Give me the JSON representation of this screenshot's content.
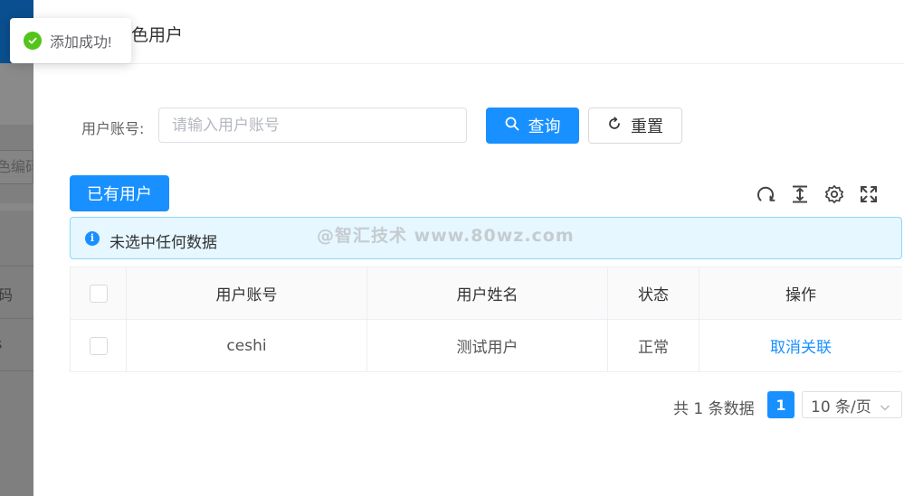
{
  "background_page": {
    "field_text": "色编码",
    "row1_text": "码",
    "row2_text": "s"
  },
  "drawer": {
    "title": "色用户",
    "search": {
      "label": "用户账号:",
      "placeholder": "请输入用户账号",
      "value": "",
      "query_label": "查询",
      "reset_label": "重置"
    },
    "existing_users_label": "已有用户",
    "toolbar_icons": [
      "refresh-icon",
      "column-height-icon",
      "settings-icon",
      "fullscreen-icon"
    ],
    "alert": {
      "text": "未选中任何数据"
    },
    "watermark": "@智汇技术 www.80wz.com",
    "table": {
      "headers": [
        "用户账号",
        "用户姓名",
        "状态",
        "操作"
      ],
      "rows": [
        {
          "account": "ceshi",
          "name": "测试用户",
          "status": "正常",
          "action": "取消关联"
        }
      ]
    },
    "pagination": {
      "total_text": "共 1 条数据",
      "current_page": "1",
      "page_size": "10 条/页"
    }
  },
  "toast": {
    "text": "添加成功!"
  },
  "colors": {
    "primary": "#1890ff",
    "success": "#52c41a",
    "alert_bg": "#e6f7ff",
    "alert_border": "#91d5ff"
  }
}
